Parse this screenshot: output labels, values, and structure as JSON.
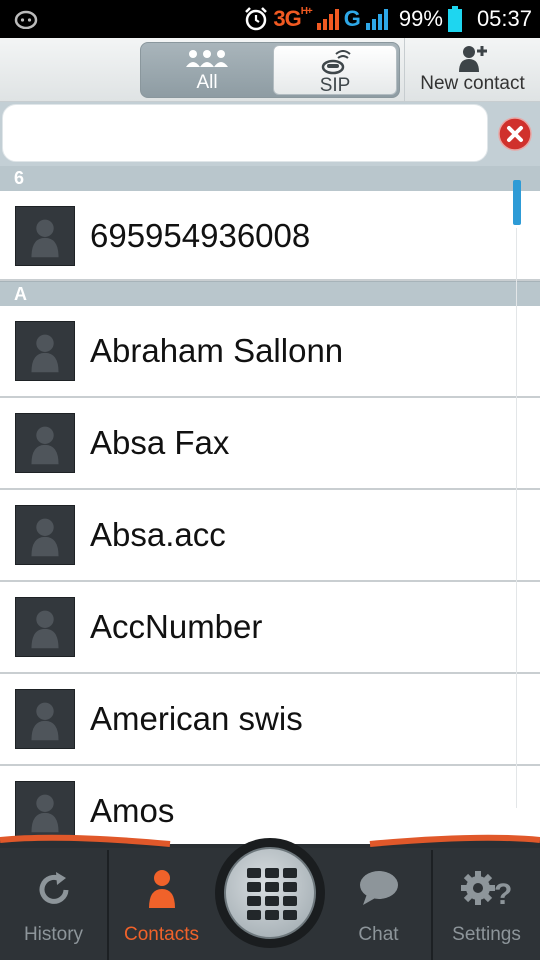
{
  "statusbar": {
    "network_label": "3G",
    "network_sup": "H+",
    "second_network_label": "G",
    "battery": "99%",
    "time": "05:37"
  },
  "toolbar": {
    "segment_all_label": "All",
    "segment_sip_label": "SIP",
    "new_contact_label": "New contact"
  },
  "search": {
    "value": "",
    "placeholder": ""
  },
  "sections": [
    {
      "letter": "6",
      "contacts": [
        {
          "name": "695954936008"
        }
      ]
    },
    {
      "letter": "A",
      "contacts": [
        {
          "name": "Abraham Sallonn"
        },
        {
          "name": "Absa Fax"
        },
        {
          "name": "Absa.acc"
        },
        {
          "name": "AccNumber"
        },
        {
          "name": "American swis"
        },
        {
          "name": "Amos"
        }
      ]
    }
  ],
  "bottom_nav": {
    "history_label": "History",
    "contacts_label": "Contacts",
    "chat_label": "Chat",
    "settings_label": "Settings"
  },
  "colors": {
    "accent": "#f0622a",
    "scroll_accent": "#2e9bd6",
    "section_header": "#b9c6cc",
    "clear_button": "#d0312c"
  },
  "icons": {
    "app_status": "cat-face-icon",
    "alarm": "alarm-clock-icon",
    "signal": "signal-bars-icon",
    "battery": "battery-icon",
    "segment_all": "group-people-icon",
    "segment_sip": "sip-phone-icon",
    "new_contact": "add-person-icon",
    "clear": "clear-x-icon",
    "avatar": "person-silhouette-icon",
    "history": "refresh-history-icon",
    "contacts": "person-icon",
    "dialpad": "dialpad-grid-icon",
    "chat": "chat-bubble-icon",
    "settings": "gears-question-icon"
  }
}
